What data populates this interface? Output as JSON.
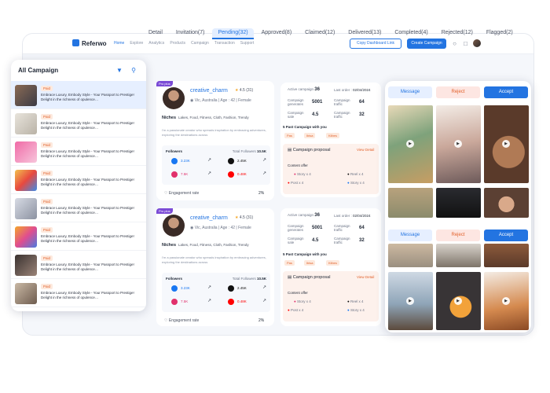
{
  "header": {
    "brand": "Referwo",
    "nav": [
      "Home",
      "Explore",
      "Analytics",
      "Products",
      "Campaign",
      "Transaction",
      "Support"
    ],
    "btn_dashboard": "Copy Dashboard Link",
    "btn_create": "Create Campaign"
  },
  "tabs": [
    {
      "label": "Detail"
    },
    {
      "label": "Invitation(7)"
    },
    {
      "label": "Pending(32)"
    },
    {
      "label": "Approved(8)"
    },
    {
      "label": "Claimed(12)"
    },
    {
      "label": "Delivered(13)"
    },
    {
      "label": "Completed(4)"
    },
    {
      "label": "Rejected(12)"
    },
    {
      "label": "Flagged(2)"
    }
  ],
  "left_panel": {
    "title": "All Campaign",
    "badge": "Paid",
    "item_text": "Embrace Luxury, Embody Style - Your Passport to Prestige! Delight in the richness of opulence…",
    "items": 8
  },
  "creator": {
    "pro": "Pro plus",
    "name": "creative_charm",
    "rating": "4.5",
    "reviews": "(31)",
    "location": "Vic, Australia",
    "age": "Age : 42",
    "gender": "Female",
    "niches_label": "Niches",
    "niches": "Lakes, Food, Fitness, Cloth, Fashion, Trendy",
    "description": "I'm a passionate creator who spreads inspiration by embracing adventures, exploring the destinations across",
    "followers_label": "Followers",
    "total_label": "Total Followers",
    "total": "10.5K",
    "stats": [
      {
        "v": "3.23K",
        "color": "#1877f2"
      },
      {
        "v": "2.45K",
        "color": "#111111"
      },
      {
        "v": "7.5K",
        "color": "#e1306c"
      },
      {
        "v": "0.48K",
        "color": "#ff0000"
      }
    ],
    "engagement_label": "Engagement rate",
    "engagement": "2%"
  },
  "proposal": {
    "campaign_label": "Active campaign",
    "campaign_count": "36",
    "last_order_label": "Last order",
    "last_order": "02/04/2024",
    "metrics": [
      {
        "l": "Campaign generates",
        "v": "5001"
      },
      {
        "l": "Campaign traffic",
        "v": "64"
      },
      {
        "l": "Campaign sale",
        "v": "4.5"
      },
      {
        "l": "Campaign traffic",
        "v": "32"
      }
    ],
    "past_label": "5 Past Campaign with you",
    "tags": [
      "Pas",
      "Ibisa",
      "Kilbes"
    ],
    "proposal_label": "Campaign proposal",
    "view_detail": "View Detail",
    "offer_label": "Content offer",
    "offers": [
      "Story",
      "Reel",
      "Post",
      "Story"
    ],
    "offer_qty": "x 4"
  },
  "actions": {
    "message": "Message",
    "reject": "Reject",
    "accept": "Accept"
  }
}
